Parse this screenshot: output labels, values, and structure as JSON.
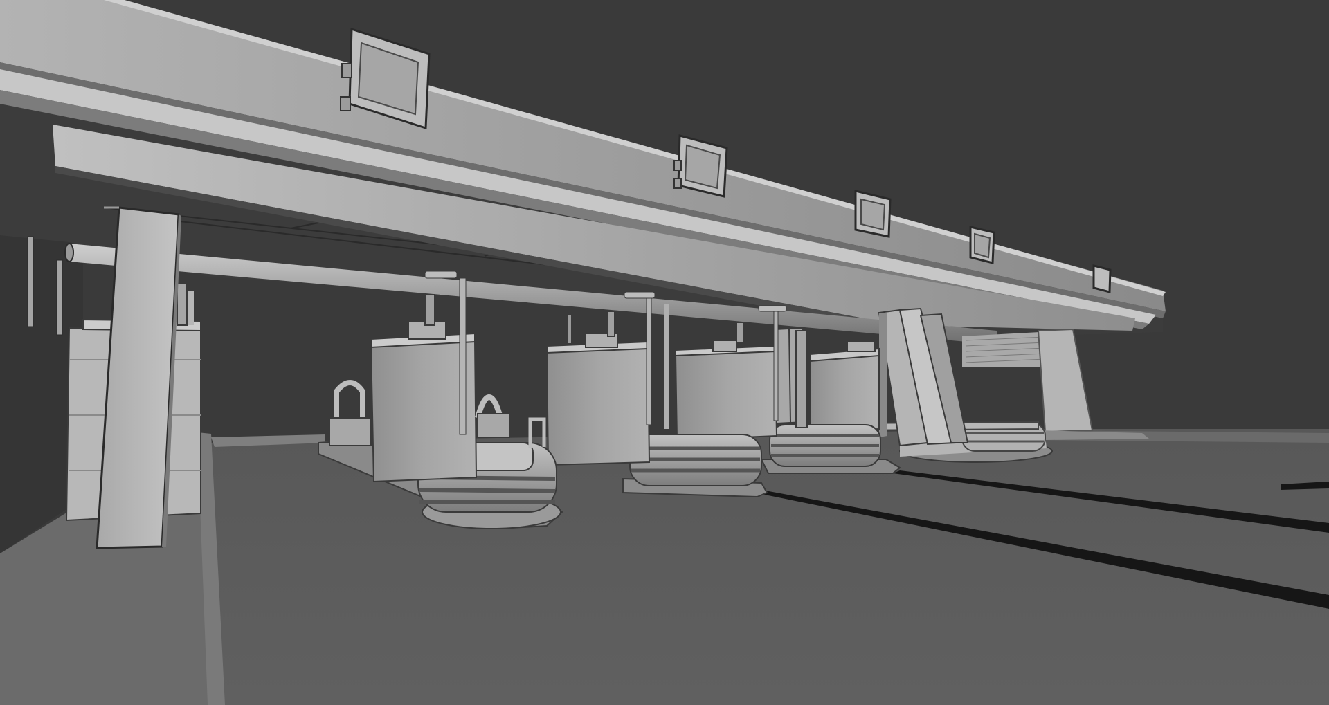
{
  "scene": {
    "subject": "toll-plaza-grey-model",
    "render_style": "untextured-grey-3d",
    "colors": {
      "background": "#3a3a3a",
      "ground": "#5d5d5d",
      "ground_dark": "#555555",
      "sidewalk": "#6e6e6e",
      "canopy_light": "#a8a8a8",
      "canopy_mid": "#8f8f8f",
      "canopy_underside": "#3f3f3f",
      "structure_light": "#b8b8b8",
      "structure_mid": "#9a9a9a",
      "shadow": "#1c1c1c",
      "edge": "#2a2a2a"
    }
  }
}
